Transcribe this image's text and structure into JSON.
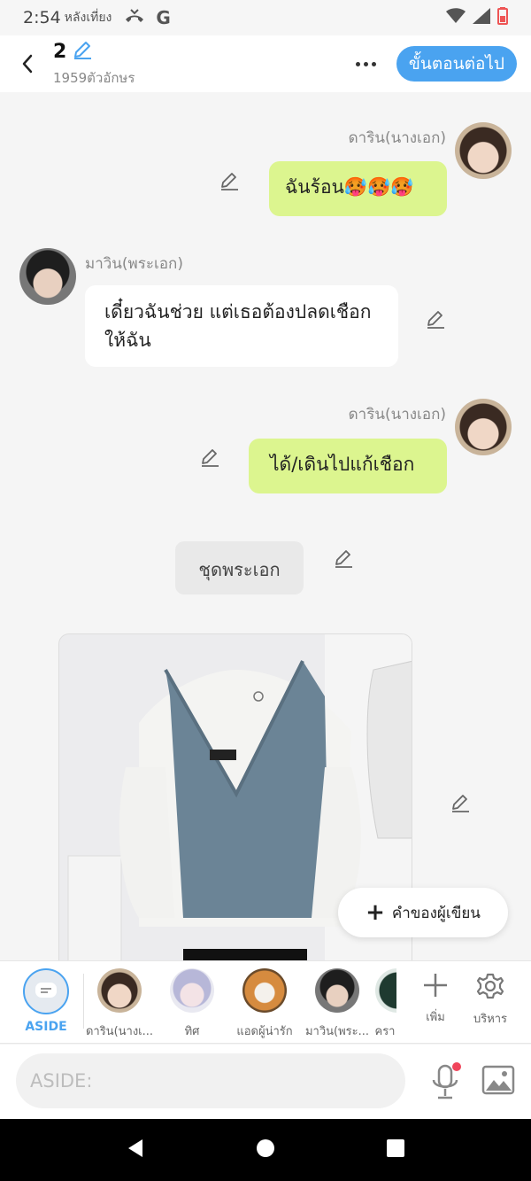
{
  "status_bar": {
    "time": "2:54",
    "period": "หลังเที่ยง",
    "icons": [
      "missed-call-icon",
      "google-icon",
      "wifi-icon",
      "signal-icon",
      "battery-icon"
    ]
  },
  "header": {
    "title": "2",
    "subtitle": "1959ตัวอักษร",
    "next_label": "ขั้นตอนต่อไป"
  },
  "messages": [
    {
      "sender": "ดาริน(นางเอก)",
      "text": "ฉันร้อน🥵🥵🥵",
      "side": "right"
    },
    {
      "sender": "มาวิน(พระเอก)",
      "text": "เดี๋ยวฉันช่วย แต่เธอต้องปลดเชือกให้ฉัน",
      "side": "left"
    },
    {
      "sender": "ดาริน(นางเอก)",
      "text": "ได้/เดินไปแก้เชือก",
      "side": "right"
    },
    {
      "narration": "ชุดพระเอก"
    }
  ],
  "author_note_label": "คำของผู้เขียน",
  "character_bar": {
    "aside_label": "ASIDE",
    "characters": [
      {
        "name": "ดาริน(นางเ..."
      },
      {
        "name": "ทิศ"
      },
      {
        "name": "แอดผู้น่ารัก"
      },
      {
        "name": "มาวิน(พระ..."
      },
      {
        "name": "ครา"
      }
    ],
    "add_label": "เพิ่ม",
    "manage_label": "บริหาร"
  },
  "input": {
    "placeholder": "ASIDE:"
  },
  "colors": {
    "accent": "#4aa3f0",
    "bubble_right": "#dcf58f",
    "bubble_left": "#ffffff"
  }
}
